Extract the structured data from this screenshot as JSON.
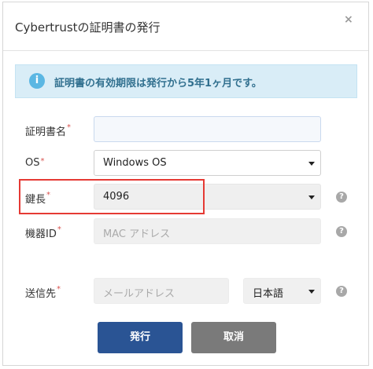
{
  "dialog": {
    "title": "Cybertrustの証明書の発行",
    "close_glyph": "×"
  },
  "info": {
    "icon": "info-icon",
    "icon_glyph": "i",
    "message": "証明書の有効期限は発行から5年1ヶ月です。"
  },
  "form": {
    "cert_name": {
      "label": "証明書名",
      "required": "*",
      "value": ""
    },
    "os": {
      "label": "OS",
      "required": "*",
      "value": "Windows OS"
    },
    "key_length": {
      "label": "鍵長",
      "required": "*",
      "value": "4096"
    },
    "device_id": {
      "label": "機器ID",
      "required": "*",
      "placeholder": "MAC アドレス"
    },
    "send_to": {
      "label": "送信先",
      "required": "*",
      "placeholder": "メールアドレス",
      "language": "日本語"
    },
    "help_glyph": "?"
  },
  "buttons": {
    "issue": "発行",
    "cancel": "取消"
  },
  "colors": {
    "primary": "#2a5494",
    "secondary": "#7a7a7a",
    "info_bg": "#d9edf7",
    "required": "#d9534f",
    "highlight": "#e53a34"
  }
}
